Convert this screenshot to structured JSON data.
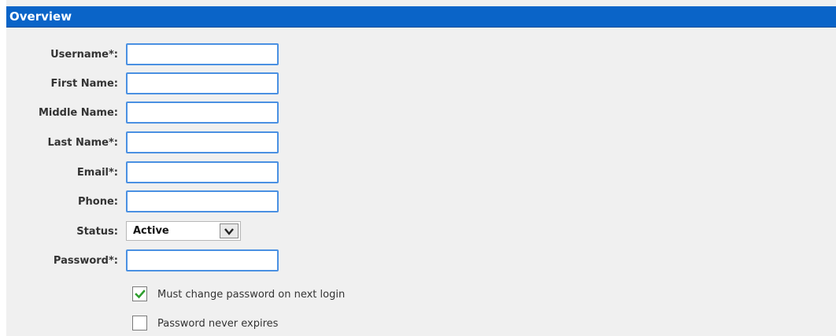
{
  "section": {
    "title": "Overview"
  },
  "form": {
    "fields": [
      {
        "label": "Username*:",
        "value": ""
      },
      {
        "label": "First Name:",
        "value": ""
      },
      {
        "label": "Middle Name:",
        "value": ""
      },
      {
        "label": "Last Name*:",
        "value": ""
      },
      {
        "label": "Email*:",
        "value": ""
      },
      {
        "label": "Phone:",
        "value": ""
      }
    ],
    "status": {
      "label": "Status:",
      "selected": "Active",
      "dropdown_icon": "chevron-down-icon"
    },
    "password": {
      "label": "Password*:",
      "value": ""
    },
    "checkboxes": [
      {
        "label": "Must change password on next login",
        "checked": true
      },
      {
        "label": "Password never expires",
        "checked": false
      }
    ]
  },
  "colors": {
    "header_bg": "#0a64c8",
    "input_border": "#4a90e2",
    "panel_bg": "#f0f0f0",
    "check_green": "#2e9e2e"
  }
}
